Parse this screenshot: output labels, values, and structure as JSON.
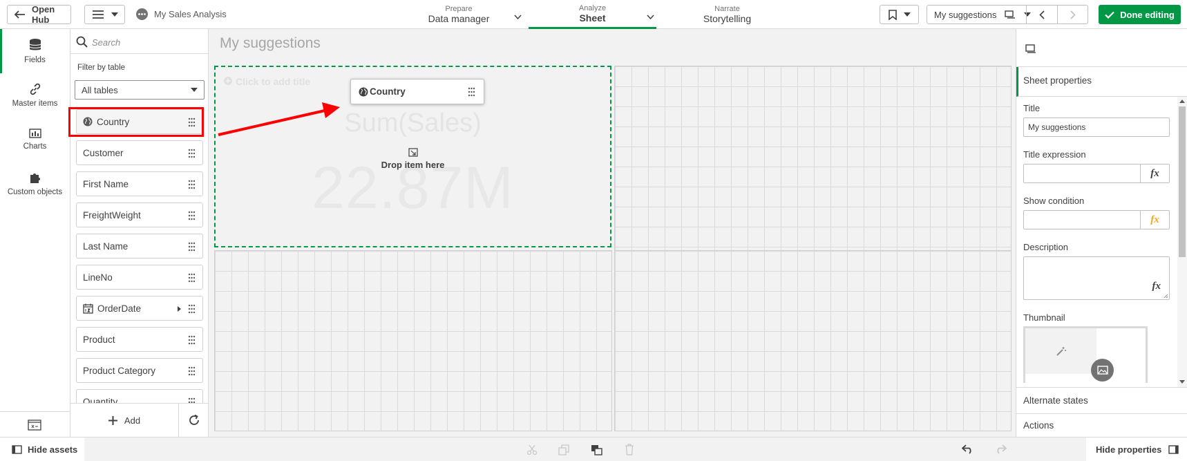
{
  "topbar": {
    "open_hub": "Open Hub",
    "app_name": "My Sales Analysis",
    "tabs": [
      {
        "small": "Prepare",
        "big": "Data manager"
      },
      {
        "small": "Analyze",
        "big": "Sheet"
      },
      {
        "small": "Narrate",
        "big": "Storytelling"
      }
    ],
    "sheet_selector": "My suggestions",
    "done_editing": "Done editing"
  },
  "leftnav": {
    "items": [
      {
        "label": "Fields",
        "icon": "database-icon"
      },
      {
        "label": "Master items",
        "icon": "link-icon"
      },
      {
        "label": "Charts",
        "icon": "bar-chart-icon"
      },
      {
        "label": "Custom objects",
        "icon": "puzzle-icon"
      }
    ]
  },
  "fields_panel": {
    "search_placeholder": "Search",
    "filter_label": "Filter by table",
    "filter_value": "All tables",
    "fields": [
      "Country",
      "Customer",
      "First Name",
      "FreightWeight",
      "Last Name",
      "LineNo",
      "OrderDate",
      "Product",
      "Product Category",
      "Quantity"
    ],
    "add_label": "Add"
  },
  "canvas": {
    "sheet_title": "My suggestions",
    "add_title_hint": "Click to add title",
    "ghost_measure": "Sum(Sales)",
    "ghost_value": "22.87M",
    "drop_hint": "Drop item here",
    "drag_item": "Country"
  },
  "properties": {
    "section": "Sheet properties",
    "title_label": "Title",
    "title_value": "My suggestions",
    "title_expr_label": "Title expression",
    "show_condition_label": "Show condition",
    "description_label": "Description",
    "thumbnail_label": "Thumbnail",
    "alternate_states": "Alternate states",
    "actions": "Actions",
    "fx": "fx"
  },
  "bottombar": {
    "hide_assets": "Hide assets",
    "hide_properties": "Hide properties"
  },
  "colors": {
    "accent_green": "#009845",
    "annotation_red": "#ff0000"
  }
}
